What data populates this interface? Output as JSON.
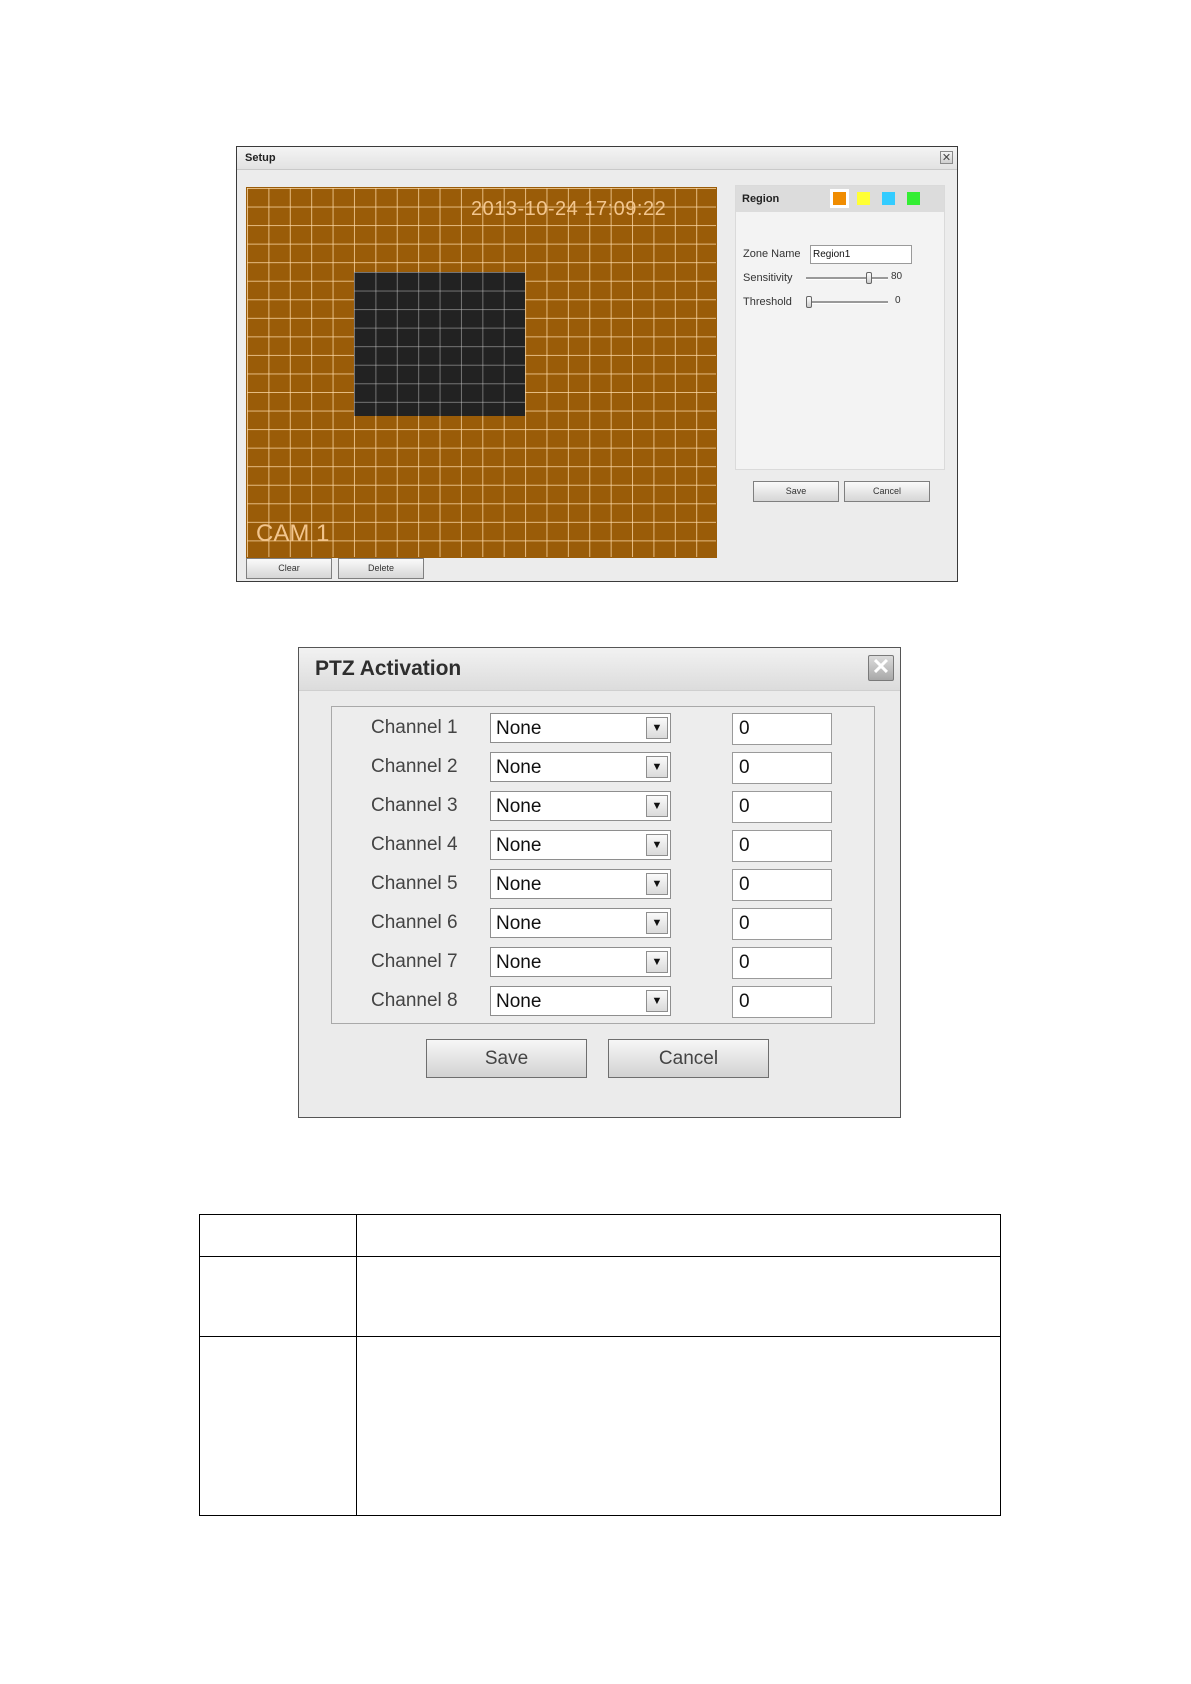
{
  "setup_dialog": {
    "title": "Setup",
    "close_glyph": "✕",
    "video": {
      "timestamp": "2013-10-24 17:09:22",
      "camera_label": "CAM 1",
      "grid_color": "#9a5c08"
    },
    "clear_label": "Clear",
    "delete_label": "Delete",
    "region": {
      "label": "Region",
      "swatches": [
        "#f08c00",
        "#ffff33",
        "#33ccff",
        "#33ee33"
      ],
      "zone_name_label": "Zone Name",
      "zone_name_value": "Region1",
      "sensitivity_label": "Sensitivity",
      "sensitivity_value": "80",
      "threshold_label": "Threshold",
      "threshold_value": "0"
    },
    "save_label": "Save",
    "cancel_label": "Cancel"
  },
  "ptz_dialog": {
    "title": "PTZ Activation",
    "close_glyph": "✕",
    "channels": [
      {
        "label": "Channel 1",
        "type": "None",
        "value": "0"
      },
      {
        "label": "Channel 2",
        "type": "None",
        "value": "0"
      },
      {
        "label": "Channel 3",
        "type": "None",
        "value": "0"
      },
      {
        "label": "Channel 4",
        "type": "None",
        "value": "0"
      },
      {
        "label": "Channel 5",
        "type": "None",
        "value": "0"
      },
      {
        "label": "Channel 6",
        "type": "None",
        "value": "0"
      },
      {
        "label": "Channel 7",
        "type": "None",
        "value": "0"
      },
      {
        "label": "Channel 8",
        "type": "None",
        "value": "0"
      }
    ],
    "save_label": "Save",
    "cancel_label": "Cancel"
  }
}
